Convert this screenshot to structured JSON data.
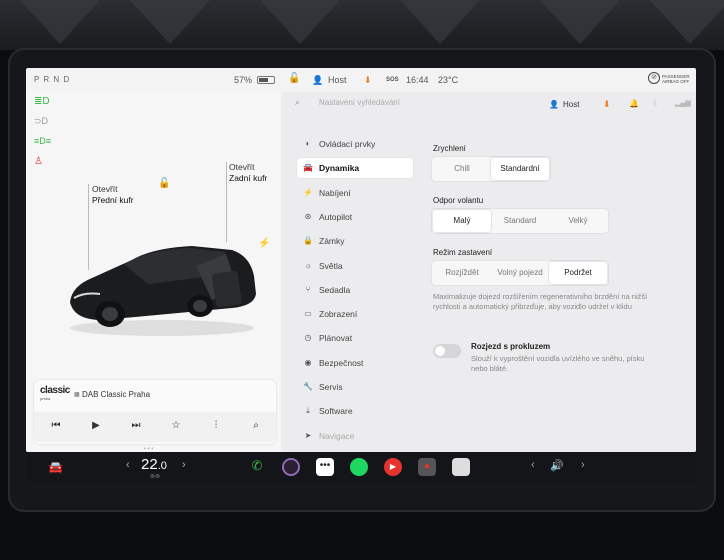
{
  "status": {
    "gear": "P R N D",
    "battery": "57%",
    "profile": "Host",
    "sos": "SOS",
    "time": "16:44",
    "temp": "23°C",
    "airbag": "PASSENGER AIRBAG OFF"
  },
  "car": {
    "front_trunk": [
      "Otevřít",
      "Přední kufr"
    ],
    "rear_trunk": [
      "Otevřít",
      "Zadní kufr"
    ]
  },
  "media": {
    "logo": "classic",
    "logo_sub": "praha",
    "station": "DAB Classic Praha"
  },
  "settings": {
    "search_placeholder": "Nastavení vyhledávání",
    "profile": "Host",
    "menu": [
      {
        "label": "Ovládací prvky",
        "icon": "toggle-icon"
      },
      {
        "label": "Dynamika",
        "icon": "car-icon"
      },
      {
        "label": "Nabíjení",
        "icon": "bolt-icon"
      },
      {
        "label": "Autopilot",
        "icon": "steering-wheel-icon"
      },
      {
        "label": "Zámky",
        "icon": "lock-icon"
      },
      {
        "label": "Světla",
        "icon": "sun-icon"
      },
      {
        "label": "Sedadla",
        "icon": "seat-icon"
      },
      {
        "label": "Zobrazení",
        "icon": "display-icon"
      },
      {
        "label": "Plánovat",
        "icon": "clock-icon"
      },
      {
        "label": "Bezpečnost",
        "icon": "shield-icon"
      },
      {
        "label": "Servis",
        "icon": "wrench-icon"
      },
      {
        "label": "Software",
        "icon": "download-icon"
      },
      {
        "label": "Navigace",
        "icon": "navigation-icon"
      }
    ],
    "acceleration": {
      "title": "Zrychlení",
      "options": [
        "Chill",
        "Standardní"
      ],
      "selected": 1
    },
    "steering": {
      "title": "Odpor volantu",
      "options": [
        "Malý",
        "Standard",
        "Velký"
      ],
      "selected": 0
    },
    "stopping": {
      "title": "Režim zastavení",
      "options": [
        "Rozjíždět",
        "Volný pojezd",
        "Podržet"
      ],
      "selected": 2
    },
    "stopping_desc": "Maximalizuje dojezd rozšířením regenerativního brzdění na nižší rychlosti a automatický přibrzďuje, aby vozidlo udržel v klidu",
    "slip_start": {
      "title": "Rozjezd s prokluzem",
      "desc": "Slouží k vyproštění vozidla uvízlého ve sněhu, písku nebo bláté."
    }
  },
  "dock": {
    "temp_int": "22",
    "temp_dec": ".0"
  },
  "colors": {
    "accent_orange": "#f07a1f",
    "telltale_green": "#3ab54a",
    "telltale_red": "#e5342f"
  }
}
